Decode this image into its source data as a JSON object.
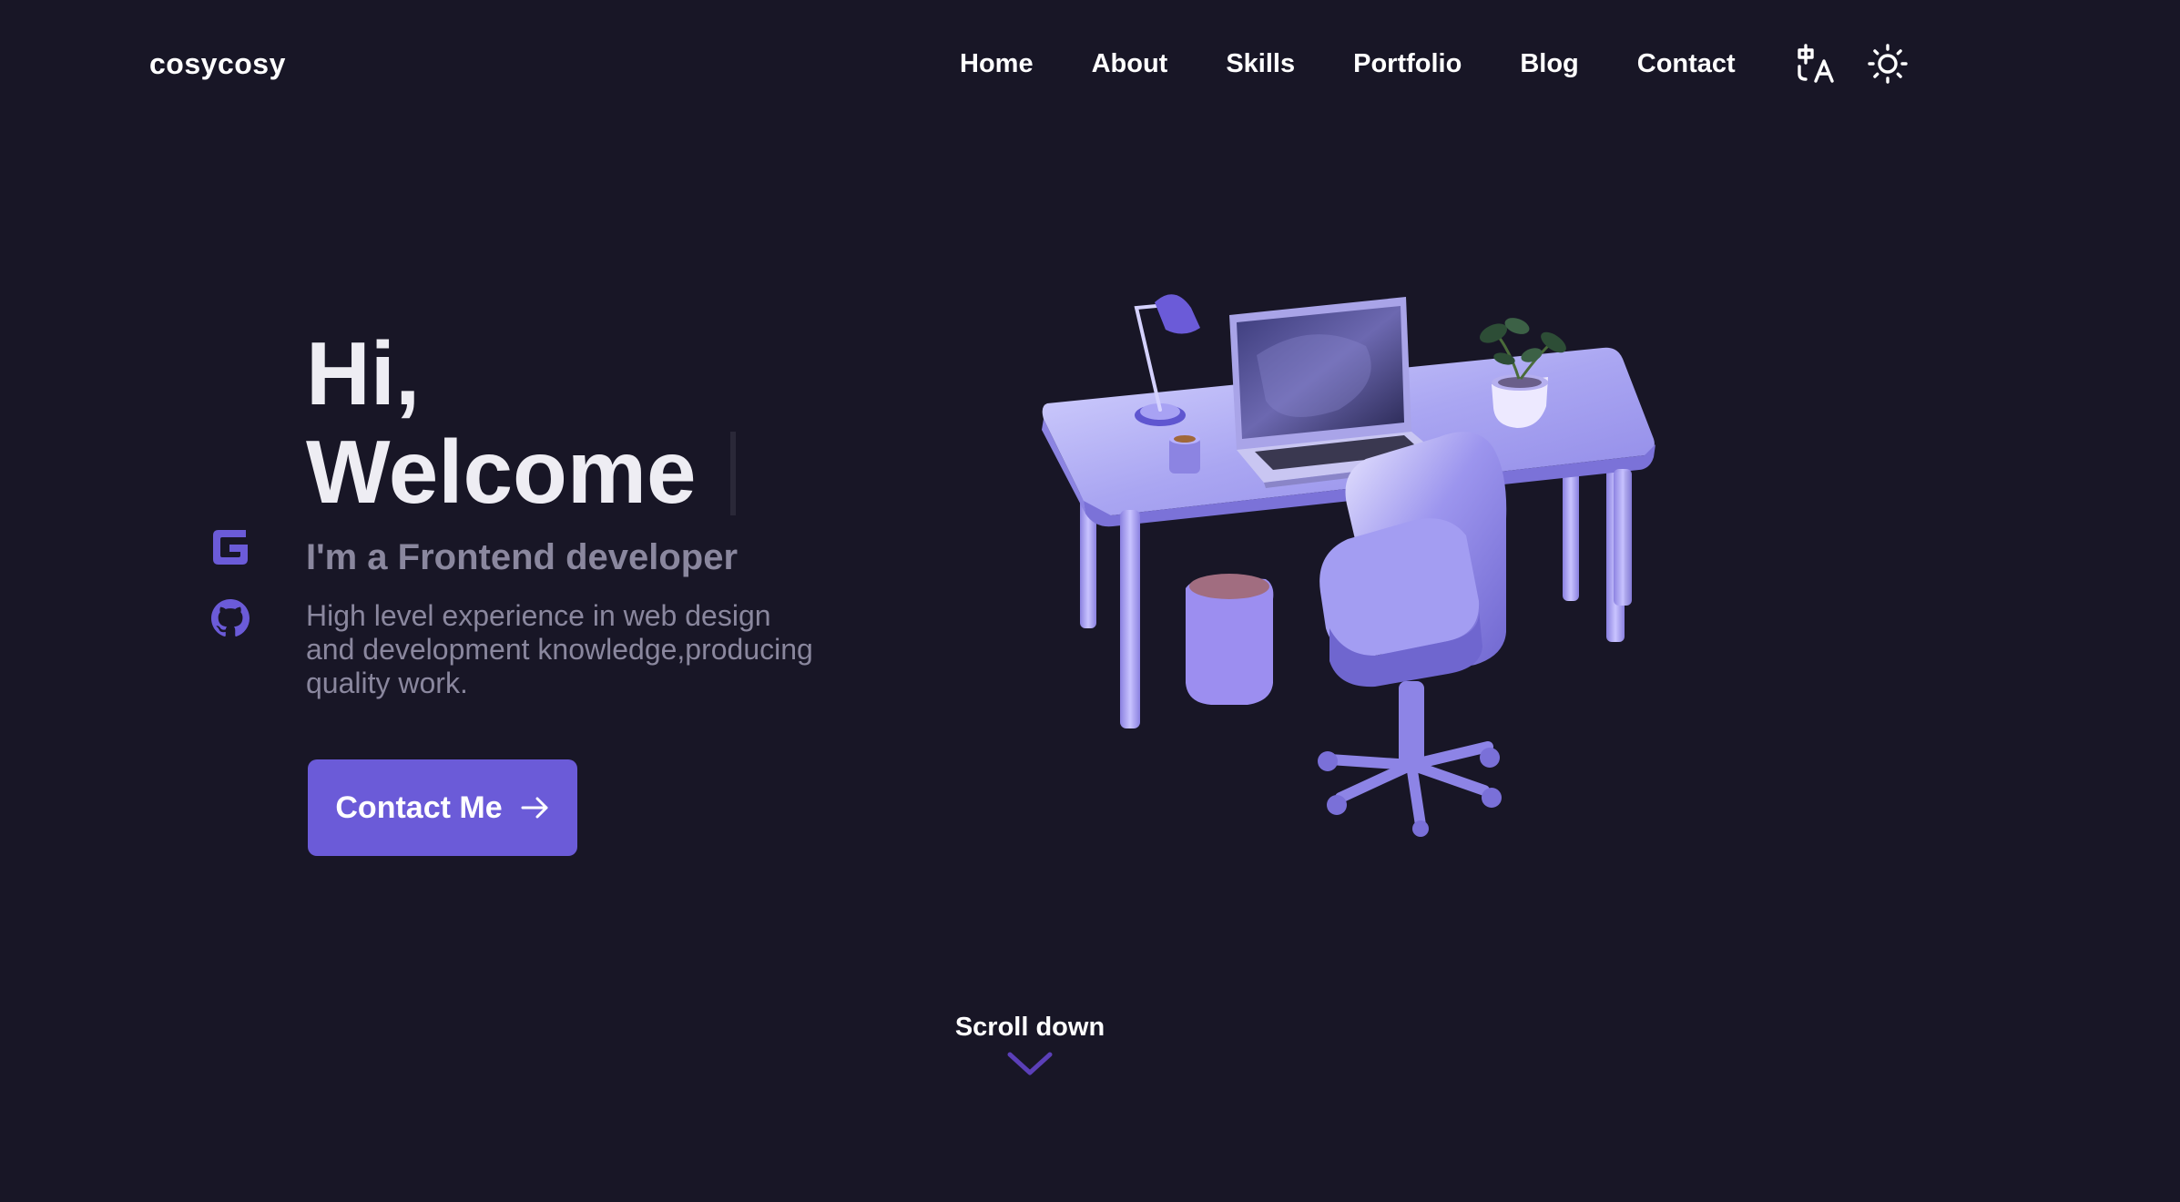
{
  "header": {
    "logo": "cosycosy",
    "nav": [
      "Home",
      "About",
      "Skills",
      "Portfolio",
      "Blog",
      "Contact"
    ],
    "icons": [
      "translate-icon",
      "sun-icon"
    ]
  },
  "social": {
    "icons": [
      "gitee-icon",
      "github-icon"
    ],
    "accent": "#6b5bd8"
  },
  "hero": {
    "greeting": "Hi,",
    "welcome": "Welcome",
    "subtitle": "I'm a Frontend developer",
    "description": "High level experience in web design and development knowledge,producing quality work.",
    "cta_label": "Contact Me",
    "cta_icon": "arrow-right-icon"
  },
  "scroll": {
    "label": "Scroll down",
    "icon": "chevron-down-icon"
  },
  "colors": {
    "background": "#181626",
    "accent": "#6b5bd8",
    "muted_text": "#8a879e",
    "text": "#ffffff"
  }
}
